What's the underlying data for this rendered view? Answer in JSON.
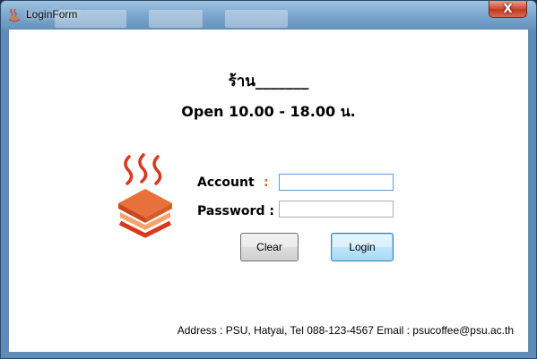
{
  "window": {
    "title": "LoginForm",
    "close_glyph": "X"
  },
  "header": {
    "shop_name": "ร้าน_______",
    "hours": "Open 10.00 - 18.00 น."
  },
  "logo": {
    "icon": "coffee-cake-logo-icon",
    "steam_color": "#d9381e",
    "cake_color": "#e8703a"
  },
  "form": {
    "account_label": "Account",
    "account_colon": ":",
    "account_value": "",
    "password_label": "Password :",
    "password_value": ""
  },
  "buttons": {
    "clear_label": "Clear",
    "login_label": "Login"
  },
  "footer": {
    "address": "Address : PSU, Hatyai, Tel 088-123-4567 Email : psucoffee@psu.ac.th"
  }
}
